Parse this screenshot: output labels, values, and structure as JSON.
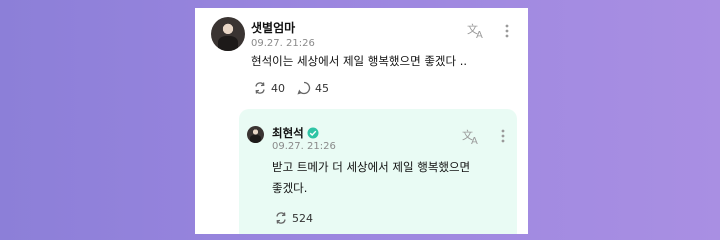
{
  "post": {
    "author": "샛별엄마",
    "time": "09.27. 21:26",
    "text": "현석이는 세상에서 제일 행복했으면 좋겠다 ..",
    "repost_count": "40",
    "comment_count": "45"
  },
  "reply": {
    "author": "최현석",
    "time": "09.27. 21:26",
    "text_line1": "받고 트메가 더 세상에서 제일 행복했으면",
    "text_line2": "좋겠다.",
    "repost_count": "524"
  },
  "icons": {
    "translate": "translate-icon",
    "more": "more-vertical-icon",
    "repost": "repost-icon",
    "comment": "comment-icon",
    "verified": "verified-badge-icon"
  },
  "colors": {
    "background": "#9b86df",
    "reply_background": "#e9fbf4",
    "verified": "#2ec4a5"
  }
}
